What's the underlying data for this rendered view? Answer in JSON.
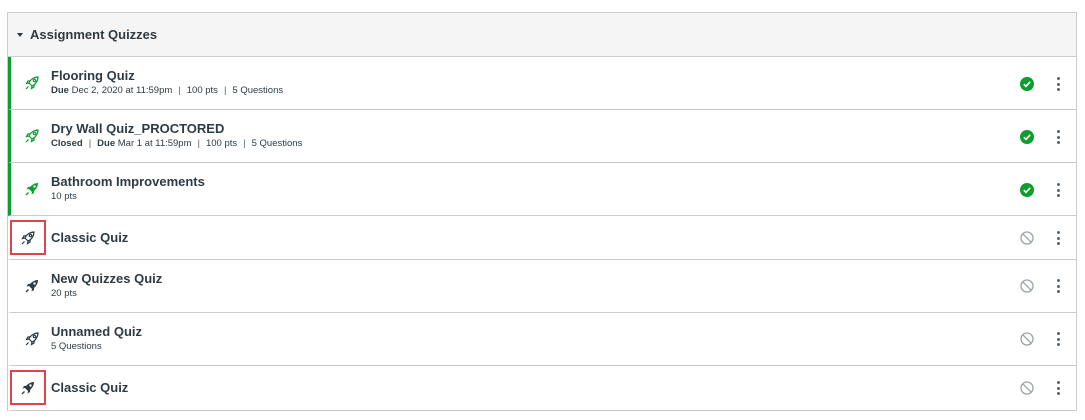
{
  "module": {
    "title": "Assignment Quizzes"
  },
  "items": [
    {
      "title": "Flooring Quiz",
      "published": true,
      "due_label": "Due",
      "due_value": "Dec 2, 2020 at 11:59pm",
      "points": "100 pts",
      "questions": "5 Questions"
    },
    {
      "title": "Dry Wall Quiz_PROCTORED",
      "published": true,
      "closed": "Closed",
      "due_label": "Due",
      "due_value": "Mar 1 at 11:59pm",
      "points": "100 pts",
      "questions": "5 Questions"
    },
    {
      "title": "Bathroom Improvements",
      "published": true,
      "points": "10 pts"
    },
    {
      "title": "Classic Quiz",
      "published": false
    },
    {
      "title": "New Quizzes Quiz",
      "published": false,
      "points": "20 pts"
    },
    {
      "title": "Unnamed Quiz",
      "published": false,
      "questions": "5 Questions"
    },
    {
      "title": "Classic Quiz",
      "published": false
    }
  ],
  "icons": {
    "classic_quiz": "rocket-outline-icon",
    "new_quiz": "rocket-solid-icon",
    "published": "check-circle-icon",
    "unpublished": "unpublished-circle-icon",
    "menu": "kebab-menu-icon"
  },
  "colors": {
    "published": "#0b9e2e",
    "highlight": "#e0434a",
    "muted": "#9aa3aa"
  }
}
